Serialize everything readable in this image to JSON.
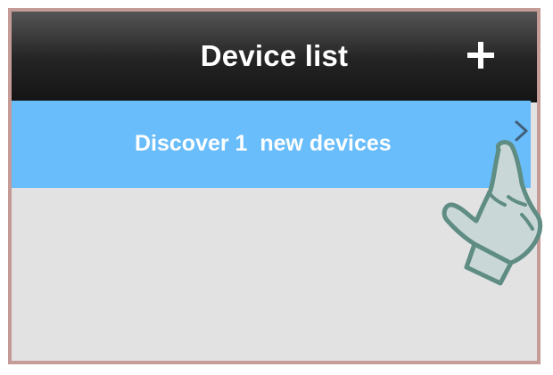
{
  "header": {
    "title": "Device list",
    "add_icon": "plus-icon"
  },
  "discover_row": {
    "label": "Discover 1  new devices",
    "chevron_icon": "chevron-right-icon"
  },
  "overlay": {
    "pointer_icon": "hand-pointer-icon"
  },
  "colors": {
    "header_bg": "#1d1d1d",
    "row_bg": "#69bdfa",
    "content_bg": "#e2e2e2",
    "frame_border": "#c49b97",
    "hand_outline": "#5f8c83",
    "hand_fill": "#c9d7d7"
  }
}
